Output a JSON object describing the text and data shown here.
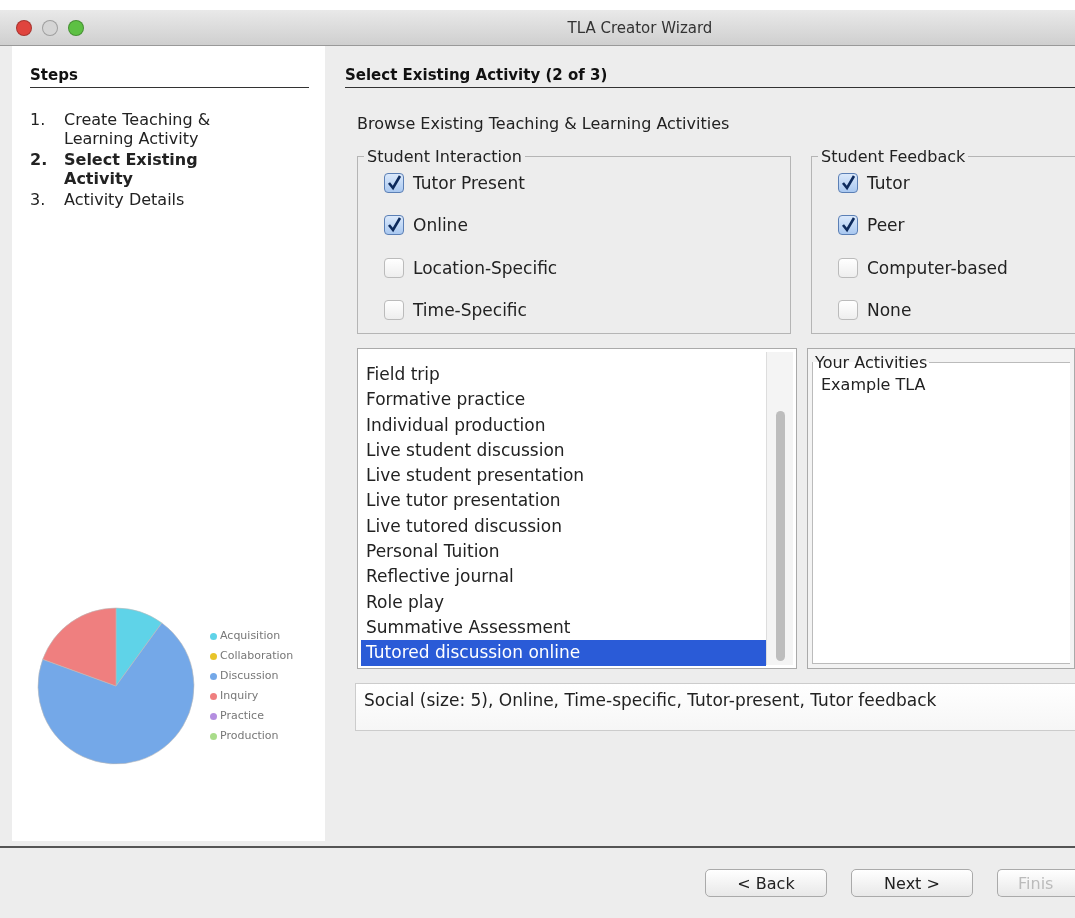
{
  "window": {
    "title": "TLA Creator Wizard"
  },
  "steps": {
    "heading": "Steps",
    "items": [
      {
        "number": "1.",
        "label": "Create Teaching & Learning Activity",
        "selected": false
      },
      {
        "number": "2.",
        "label": "Select Existing Activity",
        "selected": true
      },
      {
        "number": "3.",
        "label": "Activity Details",
        "selected": false
      }
    ]
  },
  "legend": [
    {
      "label": "Acquisition",
      "color": "#5fd3e8"
    },
    {
      "label": "Collaboration",
      "color": "#e8c42a"
    },
    {
      "label": "Discussion",
      "color": "#74a8e8"
    },
    {
      "label": "Inquiry",
      "color": "#ef7f7f"
    },
    {
      "label": "Practice",
      "color": "#b48ee0"
    },
    {
      "label": "Production",
      "color": "#a9dc8a"
    }
  ],
  "page": {
    "heading": "Select Existing Activity (2 of 3)",
    "intro": "Browse Existing Teaching & Learning Activities"
  },
  "groups": [
    {
      "title": "Student Interaction",
      "options": [
        {
          "label": "Tutor Present",
          "checked": true
        },
        {
          "label": "Online",
          "checked": true
        },
        {
          "label": "Location-Specific",
          "checked": false
        },
        {
          "label": "Time-Specific",
          "checked": false
        }
      ]
    },
    {
      "title": "Student Feedback",
      "options": [
        {
          "label": "Tutor",
          "checked": true
        },
        {
          "label": "Peer",
          "checked": true
        },
        {
          "label": "Computer-based",
          "checked": false
        },
        {
          "label": "None",
          "checked": false
        }
      ]
    }
  ],
  "activities": [
    {
      "label": "Field trip",
      "selected": false
    },
    {
      "label": "Formative practice",
      "selected": false
    },
    {
      "label": "Individual production",
      "selected": false
    },
    {
      "label": "Live student discussion",
      "selected": false
    },
    {
      "label": "Live student presentation",
      "selected": false
    },
    {
      "label": "Live tutor presentation",
      "selected": false
    },
    {
      "label": "Live tutored discussion",
      "selected": false
    },
    {
      "label": "Personal Tuition",
      "selected": false
    },
    {
      "label": "Reflective journal",
      "selected": false
    },
    {
      "label": "Role play",
      "selected": false
    },
    {
      "label": "Summative Assessment",
      "selected": false
    },
    {
      "label": "Tutored discussion online",
      "selected": true
    }
  ],
  "your_activities": {
    "title": "Your Activities",
    "items": [
      "Example TLA"
    ]
  },
  "description": "Social (size: 5), Online, Time-specific, Tutor-present, Tutor feedback",
  "buttons": [
    {
      "label": "< Back",
      "disabled": false
    },
    {
      "label": "Next >",
      "disabled": false
    },
    {
      "label": "Finis",
      "disabled": true
    }
  ]
}
